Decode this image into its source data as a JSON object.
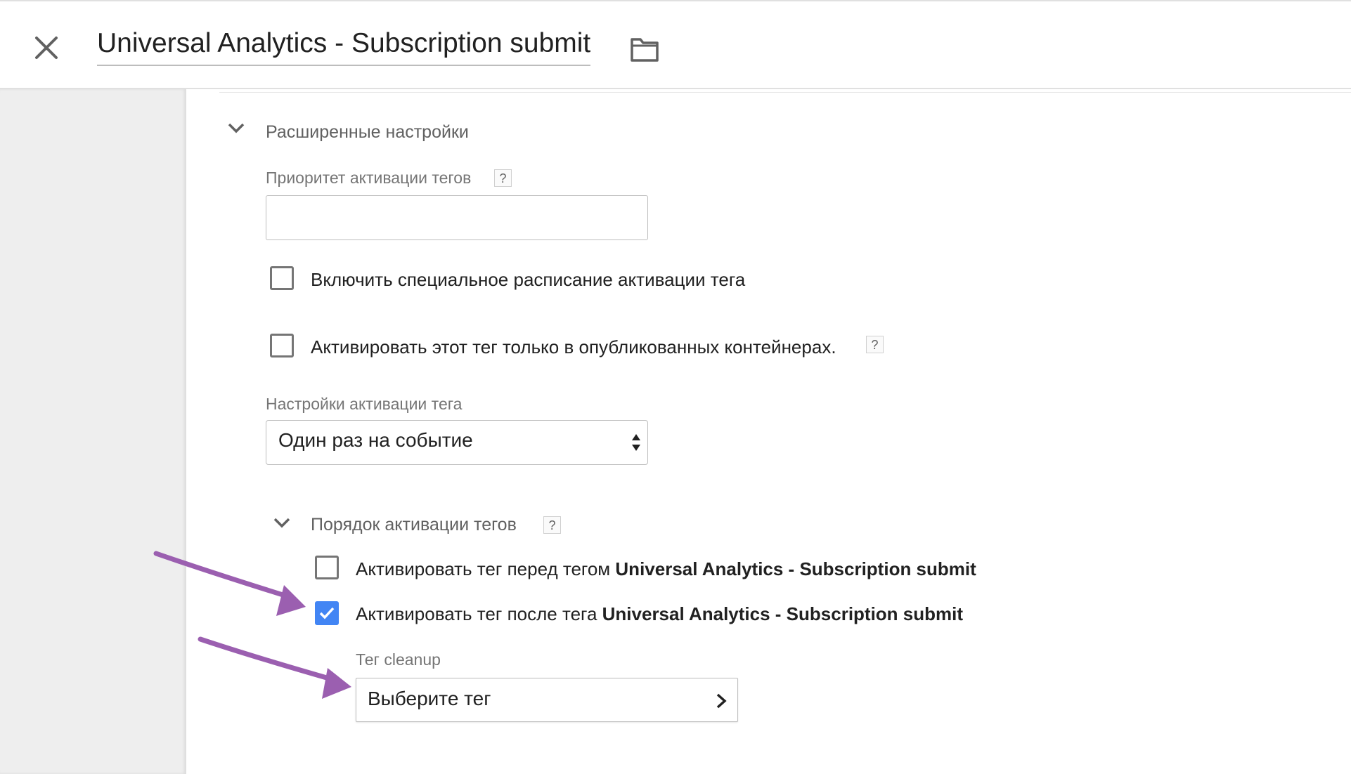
{
  "header": {
    "title": "Universal Analytics - Subscription submit"
  },
  "advanced": {
    "section_title": "Расширенные настройки",
    "priority_label": "Приоритет активации тегов",
    "priority_value": "",
    "schedule_checkbox_label": "Включить специальное расписание активации тега",
    "schedule_checked": false,
    "published_only_label": "Активировать этот тег только в опубликованных контейнерах.",
    "published_only_checked": false,
    "firing_options_label": "Настройки активации тега",
    "firing_options_value": "Один раз на событие",
    "help_glyph": "?"
  },
  "sequencing": {
    "section_title": "Порядок активации тегов",
    "before_prefix": "Активировать тег перед тегом ",
    "before_tag": "Universal Analytics - Subscription submit",
    "before_checked": false,
    "after_prefix": "Активировать тег после тега ",
    "after_tag": "Universal Analytics - Subscription submit",
    "after_checked": true,
    "cleanup_label": "Тег cleanup",
    "cleanup_value": "Выберите тег"
  },
  "icons": {
    "close": "close-icon",
    "folder": "folder-icon",
    "chevron_down": "chevron-down-icon",
    "chevron_right": "chevron-right-icon",
    "checkmark": "checkmark-icon",
    "select_arrows": "up-down-arrows-icon",
    "annotation_arrow": "arrow-annotation"
  },
  "colors": {
    "accent": "#4285f4",
    "annotation": "#9b5fb0",
    "left_pane": "#eeeeee"
  }
}
